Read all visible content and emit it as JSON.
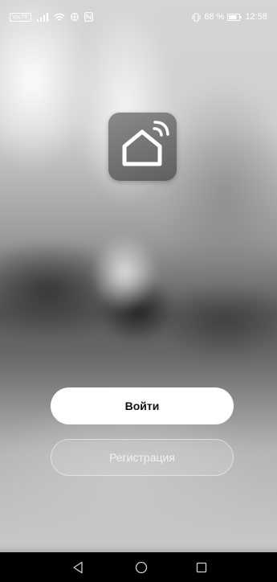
{
  "status_bar": {
    "volte": "VoLTE",
    "battery_percent": "68 %",
    "time": "12:58"
  },
  "app": {
    "logo_icon": "smart-home-icon",
    "login_label": "Войти",
    "register_label": "Регистрация"
  },
  "nav_bar": {
    "back_icon": "back-triangle-icon",
    "home_icon": "home-circle-icon",
    "recents_icon": "recents-square-icon"
  }
}
